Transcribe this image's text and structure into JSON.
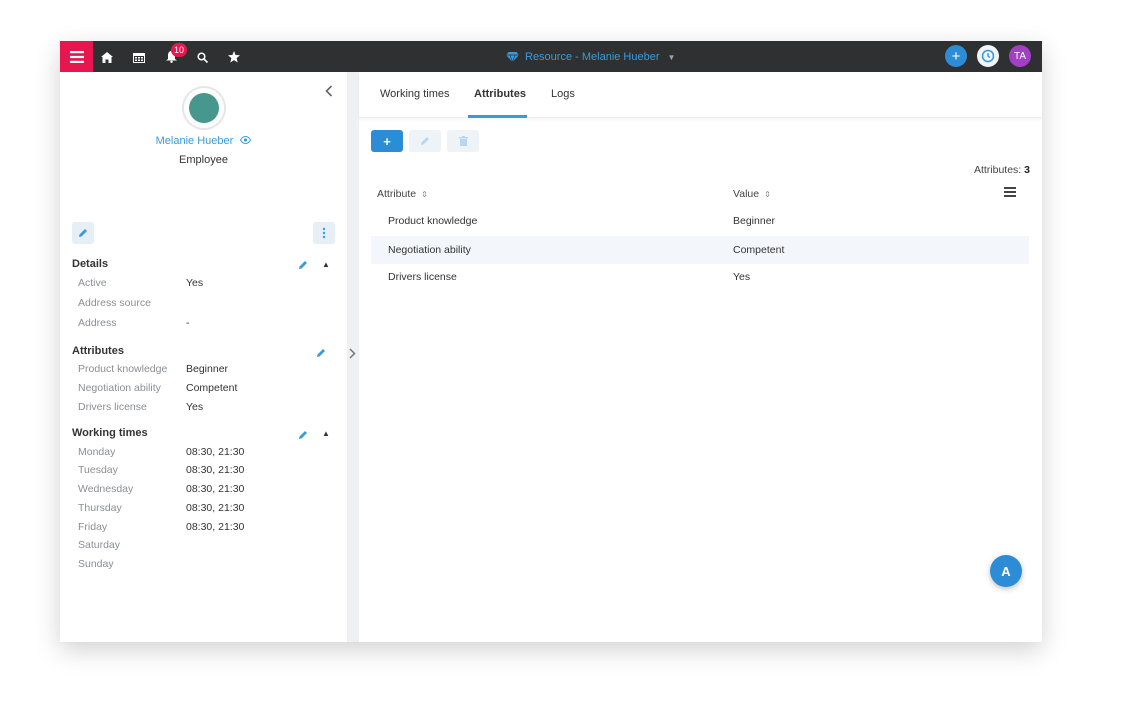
{
  "topbar": {
    "notification_count": "10",
    "title": "Resource - Melanie Hueber",
    "user_initials": "TA",
    "colors": {
      "bar": "#2f3031",
      "menu": "#e8164f",
      "accent": "#3a9bdc",
      "avatar": "#a23fc4"
    }
  },
  "profile": {
    "name": "Melanie Hueber",
    "role": "Employee"
  },
  "details": {
    "title": "Details",
    "rows": [
      {
        "label": "Active",
        "value": "Yes"
      },
      {
        "label": "Address source",
        "value": ""
      },
      {
        "label": "Address",
        "value": "-"
      }
    ]
  },
  "attributes_section": {
    "title": "Attributes",
    "rows": [
      {
        "label": "Product knowledge",
        "value": "Beginner"
      },
      {
        "label": "Negotiation ability",
        "value": "Competent"
      },
      {
        "label": "Drivers license",
        "value": "Yes"
      }
    ]
  },
  "working_times": {
    "title": "Working times",
    "rows": [
      {
        "label": "Monday",
        "value": "08:30, 21:30"
      },
      {
        "label": "Tuesday",
        "value": "08:30, 21:30"
      },
      {
        "label": "Wednesday",
        "value": "08:30, 21:30"
      },
      {
        "label": "Thursday",
        "value": "08:30, 21:30"
      },
      {
        "label": "Friday",
        "value": "08:30, 21:30"
      },
      {
        "label": "Saturday",
        "value": ""
      },
      {
        "label": "Sunday",
        "value": ""
      }
    ]
  },
  "tabs": [
    {
      "label": "Working times",
      "active": false
    },
    {
      "label": "Attributes",
      "active": true
    },
    {
      "label": "Logs",
      "active": false
    }
  ],
  "table": {
    "count_label": "Attributes:",
    "count_value": "3",
    "columns": [
      "Attribute",
      "Value"
    ],
    "rows": [
      {
        "attribute": "Product knowledge",
        "value": "Beginner"
      },
      {
        "attribute": "Negotiation ability",
        "value": "Competent"
      },
      {
        "attribute": "Drivers license",
        "value": "Yes"
      }
    ]
  },
  "fab_label": "A"
}
